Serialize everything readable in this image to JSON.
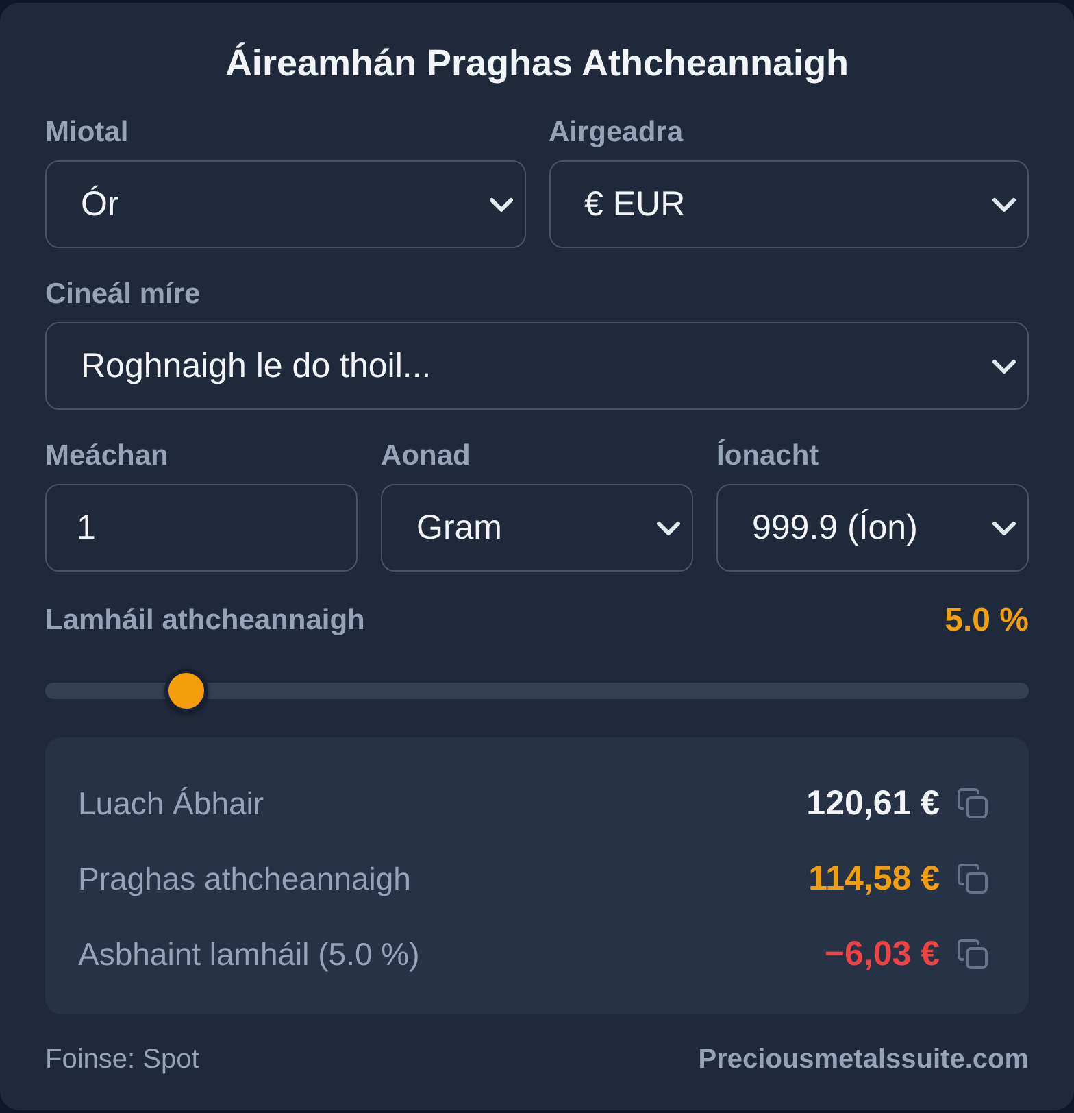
{
  "title": "Áireamhán Praghas Athcheannaigh",
  "form_rows": [
    {
      "fields": [
        {
          "kind": "select",
          "label": "Miotal",
          "value": "Ór"
        },
        {
          "kind": "select",
          "label": "Airgeadra",
          "value": "€ EUR"
        }
      ]
    },
    {
      "fields": [
        {
          "kind": "select",
          "label": "Cineál míre",
          "value": "Roghnaigh le do thoil..."
        }
      ]
    },
    {
      "fields": [
        {
          "kind": "input",
          "label": "Meáchan",
          "value": "1"
        },
        {
          "kind": "select",
          "label": "Aonad",
          "value": "Gram"
        },
        {
          "kind": "select",
          "label": "Íonacht",
          "value": "999.9 (Íon)"
        }
      ]
    }
  ],
  "slider": {
    "label": "Lamháil athcheannaigh",
    "reading": "5.0 %",
    "level": 0.143
  },
  "results": [
    {
      "label": "Luach Ábhair",
      "value": "120,61 €",
      "color": "#f1f5f9"
    },
    {
      "label": "Praghas athcheannaigh",
      "value": "114,58 €",
      "color": "#f59e0b"
    },
    {
      "label": "Asbhaint lamháil (5.0 %)",
      "value": "−6,03 €",
      "color": "#ef4444"
    }
  ],
  "footer": {
    "source": "Foinse: Spot",
    "site": "Preciousmetalssuite.com"
  }
}
